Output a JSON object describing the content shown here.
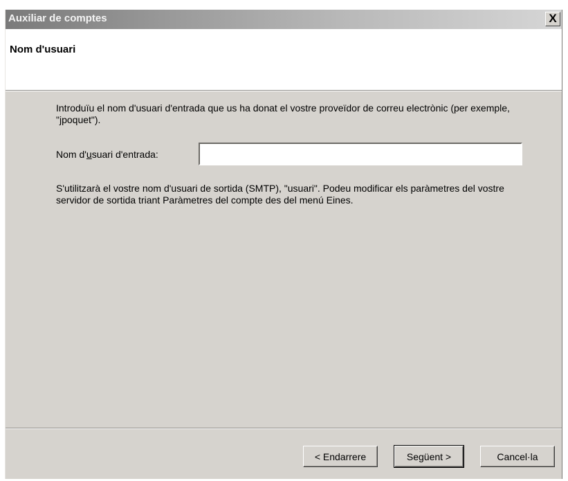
{
  "window": {
    "title": "Auxiliar de comptes",
    "close_glyph": "X"
  },
  "header": {
    "page_title": "Nom d'usuari"
  },
  "main": {
    "intro_text": "Introduïu el nom d'usuari d'entrada que us ha donat el vostre proveïdor de correu electrònic (per exemple, \"jpoquet\").",
    "field_label_prefix": "Nom d'",
    "field_label_access": "u",
    "field_label_suffix": "suari d'entrada:",
    "username_value": "",
    "info_text": "S'utilitzarà el vostre nom d'usuari de sortida (SMTP), \"usuari\". Podeu modificar els paràmetres del vostre servidor de sortida triant Paràmetres del compte des del menú Eines."
  },
  "buttons": {
    "back_label": "< Endarrere",
    "next_label": "Següent >",
    "cancel_label": "Cancel·la"
  }
}
